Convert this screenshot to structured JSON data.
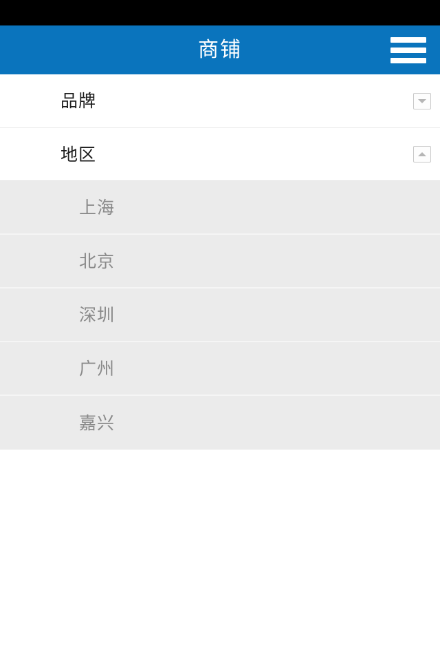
{
  "status_bar": {
    "background_color": "#000000"
  },
  "app_bar": {
    "title": "商铺",
    "background_color": "#0a74bd",
    "title_color": "#ffffff",
    "menu_icon": "hamburger-menu-icon"
  },
  "filters": [
    {
      "label": "品牌",
      "expanded": false,
      "toggle_icon": "chevron-down-icon"
    },
    {
      "label": "地区",
      "expanded": true,
      "toggle_icon": "chevron-up-icon"
    }
  ],
  "region_options": [
    {
      "label": "上海"
    },
    {
      "label": "北京"
    },
    {
      "label": "深圳"
    },
    {
      "label": "广州"
    },
    {
      "label": "嘉兴"
    }
  ],
  "colors": {
    "accent_blue": "#0a74bd",
    "sublist_background": "#ebebeb",
    "sublist_text": "#8a8a8a",
    "row_text": "#1d1d1d",
    "divider": "#ececec"
  }
}
